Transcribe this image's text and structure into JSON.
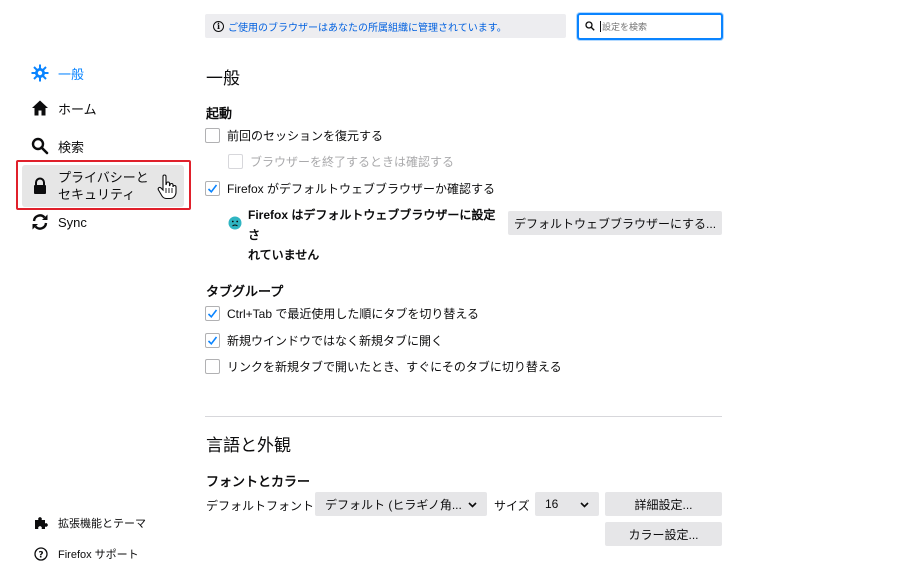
{
  "sidebar": {
    "items": [
      {
        "label": "一般",
        "icon": "gear-icon"
      },
      {
        "label": "ホーム",
        "icon": "home-icon"
      },
      {
        "label": "検索",
        "icon": "search-icon"
      },
      {
        "label": "プライバシーとセキュリティ",
        "icon": "lock-icon"
      },
      {
        "label": "Sync",
        "icon": "sync-icon"
      }
    ],
    "footer": [
      {
        "label": "拡張機能とテーマ",
        "icon": "puzzle-icon"
      },
      {
        "label": "Firefox サポート",
        "icon": "help-icon"
      }
    ]
  },
  "policy_notice": "ご使用のブラウザーはあなたの所属組織に管理されています。",
  "search": {
    "placeholder": "設定を検索"
  },
  "general": {
    "title": "一般",
    "startup": {
      "heading": "起動",
      "restore_session": "前回のセッションを復元する",
      "warn_on_quit": "ブラウザーを終了するときは確認する",
      "check_default": "Firefox がデフォルトウェブブラウザーか確認する",
      "not_default_line1": "Firefox はデフォルトウェブブラウザーに設定さ",
      "not_default_line2": "れていません",
      "make_default_button": "デフォルトウェブブラウザーにする..."
    },
    "tabs": {
      "heading": "タブグループ",
      "ctrl_tab": "Ctrl+Tab で最近使用した順にタブを切り替える",
      "open_new_tab": "新規ウインドウではなく新規タブに開く",
      "switch_to_tab": "リンクを新規タブで開いたとき、すぐにそのタブに切り替える"
    }
  },
  "language": {
    "title": "言語と外観",
    "fonts": {
      "heading": "フォントとカラー",
      "default_font_label": "デフォルトフォント",
      "default_font_value": "デフォルト (ヒラギノ角...",
      "size_label": "サイズ",
      "size_value": "16",
      "advanced_button": "詳細設定...",
      "colors_button": "カラー設定..."
    }
  },
  "colors": {
    "accent": "#0a84ff",
    "highlight": "#e0202b",
    "check": "#0a84ff"
  }
}
